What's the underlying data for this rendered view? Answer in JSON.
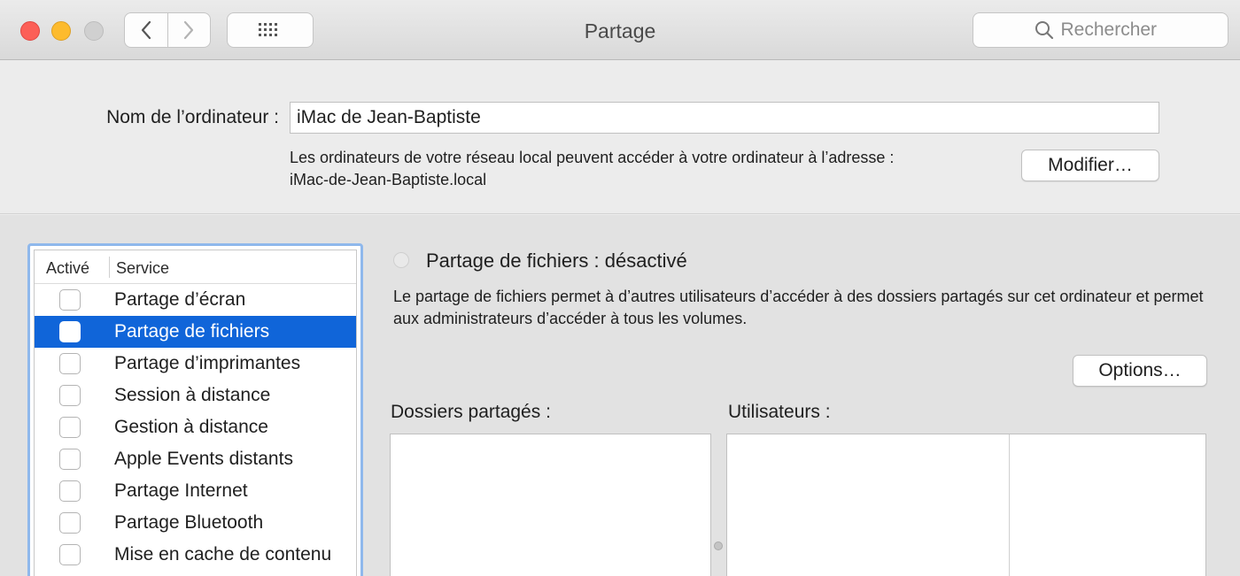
{
  "window": {
    "title": "Partage",
    "search_placeholder": "Rechercher"
  },
  "computer": {
    "name_label": "Nom de l’ordinateur :",
    "name_value": "iMac de Jean-Baptiste",
    "address_line1": "Les ordinateurs de votre réseau local peuvent accéder à votre ordinateur à l’adresse :",
    "address_line2": "iMac-de-Jean-Baptiste.local",
    "modify_label": "Modifier…"
  },
  "services": {
    "col_active": "Activé",
    "col_service": "Service",
    "items": [
      {
        "label": "Partage d’écran",
        "checked": false,
        "selected": false
      },
      {
        "label": "Partage de fichiers",
        "checked": false,
        "selected": true
      },
      {
        "label": "Partage d’imprimantes",
        "checked": false,
        "selected": false
      },
      {
        "label": "Session à distance",
        "checked": false,
        "selected": false
      },
      {
        "label": "Gestion à distance",
        "checked": false,
        "selected": false
      },
      {
        "label": "Apple Events distants",
        "checked": false,
        "selected": false
      },
      {
        "label": "Partage Internet",
        "checked": false,
        "selected": false
      },
      {
        "label": "Partage Bluetooth",
        "checked": false,
        "selected": false
      },
      {
        "label": "Mise en cache de contenu",
        "checked": false,
        "selected": false
      }
    ]
  },
  "detail": {
    "status": "Partage de fichiers : désactivé",
    "description": "Le partage de fichiers permet à d’autres utilisateurs d’accéder à des dossiers partagés sur cet ordinateur et permet aux administrateurs d’accéder à tous les volumes.",
    "options_label": "Options…",
    "shared_folders_label": "Dossiers partagés :",
    "users_label": "Utilisateurs :"
  },
  "icons": {
    "back": "chevron-left-icon",
    "forward": "chevron-right-icon",
    "grid": "grid-icon",
    "search": "search-icon"
  },
  "colors": {
    "selection": "#1065d9",
    "focus_ring": "#8fb8ec",
    "close": "#fc5f57",
    "minimize": "#fdbb2e"
  }
}
